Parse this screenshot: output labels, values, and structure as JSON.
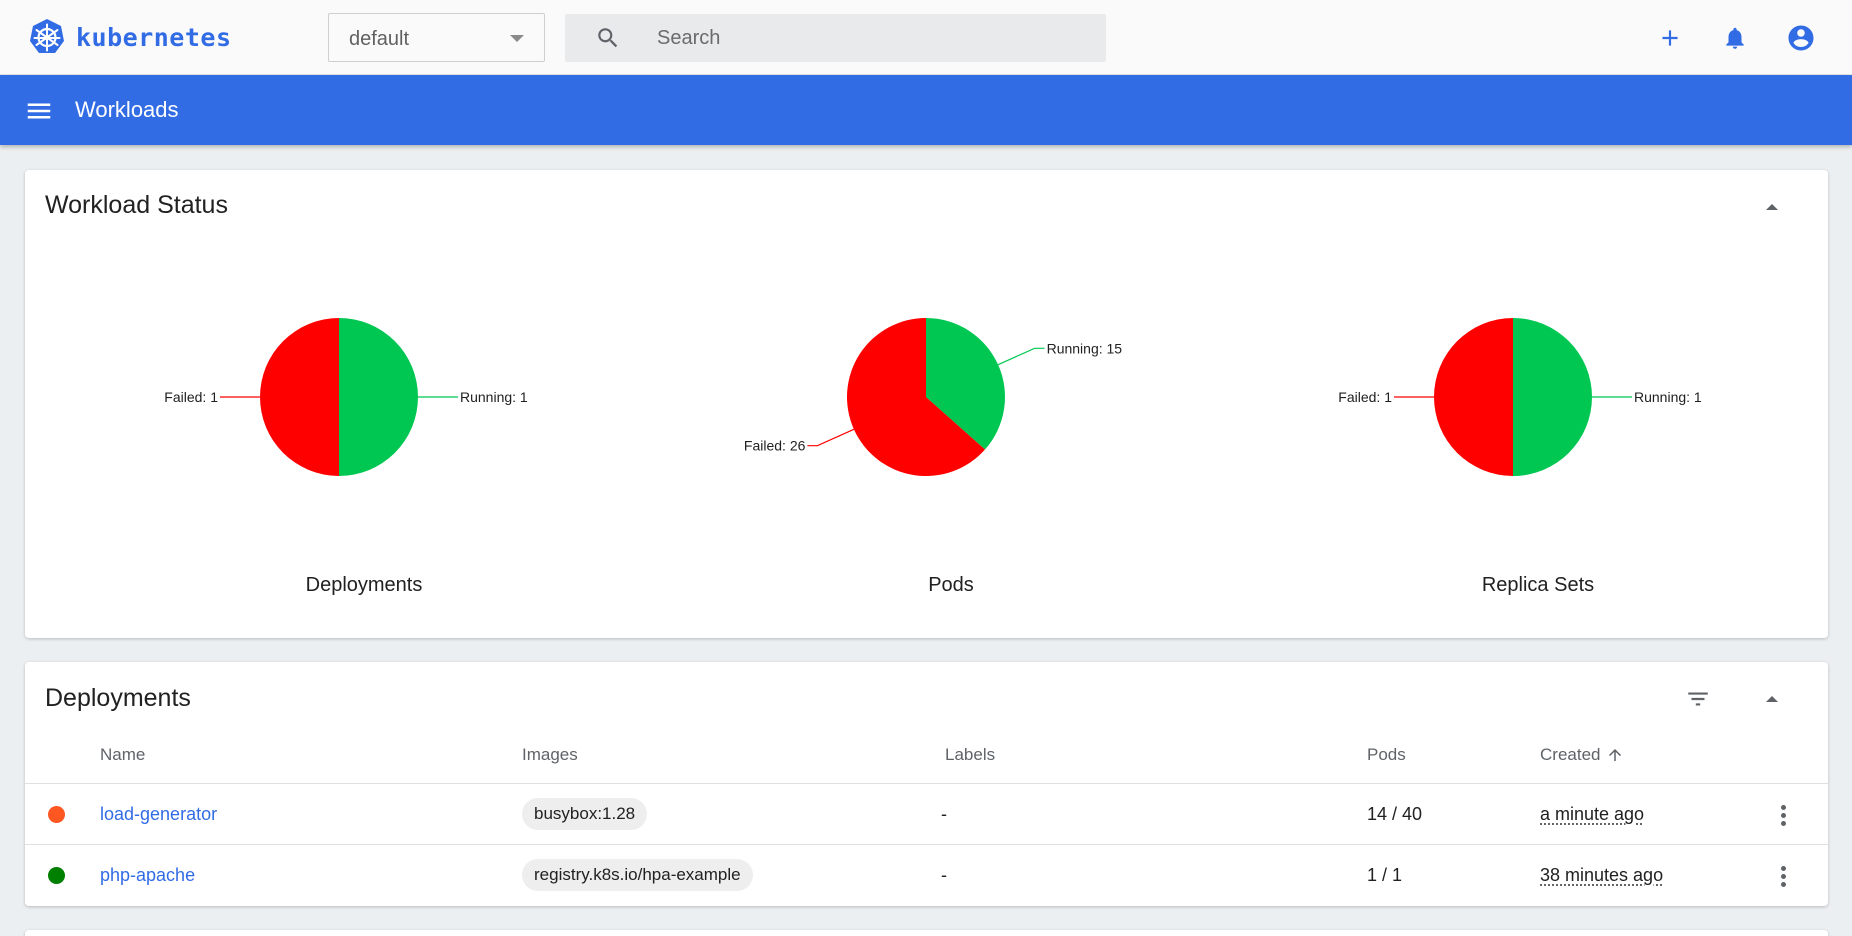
{
  "app": {
    "brand": "kubernetes"
  },
  "namespace": {
    "selected": "default"
  },
  "search": {
    "placeholder": "Search"
  },
  "header": {
    "title": "Workloads"
  },
  "workload_status": {
    "title": "Workload Status",
    "charts": [
      {
        "caption": "Deployments",
        "running_label": "Running: 1",
        "failed_label": "Failed: 1"
      },
      {
        "caption": "Pods",
        "running_label": "Running: 15",
        "failed_label": "Failed: 26"
      },
      {
        "caption": "Replica Sets",
        "running_label": "Running: 1",
        "failed_label": "Failed: 1"
      }
    ]
  },
  "chart_data": [
    {
      "type": "pie",
      "title": "Deployments",
      "categories": [
        "Running",
        "Failed"
      ],
      "values": [
        1,
        1
      ]
    },
    {
      "type": "pie",
      "title": "Pods",
      "categories": [
        "Running",
        "Failed"
      ],
      "values": [
        15,
        26
      ]
    },
    {
      "type": "pie",
      "title": "Replica Sets",
      "categories": [
        "Running",
        "Failed"
      ],
      "values": [
        1,
        1
      ]
    }
  ],
  "deployments": {
    "title": "Deployments",
    "columns": {
      "name": "Name",
      "images": "Images",
      "labels": "Labels",
      "pods": "Pods",
      "created": "Created"
    },
    "rows": [
      {
        "status": "failed",
        "name": "load-generator",
        "image": "busybox:1.28",
        "labels": "-",
        "pods": "14 / 40",
        "created": "a minute ago"
      },
      {
        "status": "running",
        "name": "php-apache",
        "image": "registry.k8s.io/hpa-example",
        "labels": "-",
        "pods": "1 / 1",
        "created": "38 minutes ago"
      }
    ]
  },
  "colors": {
    "brand": "#326ce5",
    "running": "#00c752",
    "failed": "#ff0000",
    "status_failed_dot": "#ff5722",
    "status_running_dot": "#008000"
  },
  "icons": [
    "kubernetes-logo-icon",
    "chevron-down-icon",
    "search-icon",
    "plus-icon",
    "bell-icon",
    "account-circle-icon",
    "menu-icon",
    "collapse-icon",
    "filter-icon",
    "arrow-up-icon",
    "more-vert-icon"
  ]
}
